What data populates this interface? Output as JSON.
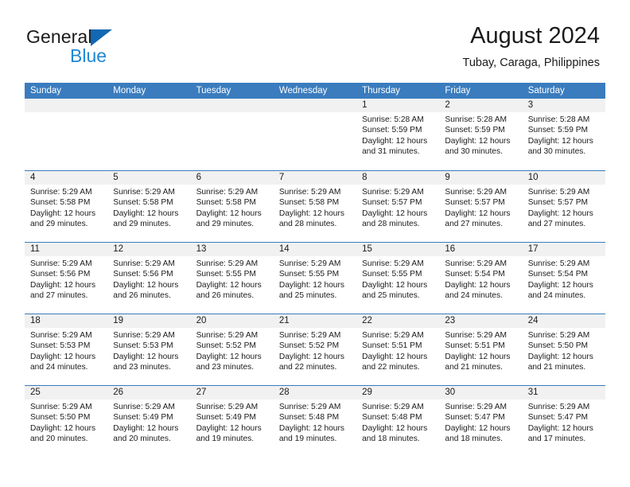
{
  "brand": {
    "name_part1": "General",
    "name_part2": "Blue",
    "logo_color": "#1268b3",
    "accent_color": "#2087d4"
  },
  "header": {
    "title": "August 2024",
    "subtitle": "Tubay, Caraga, Philippines"
  },
  "theme": {
    "header_row_bg": "#3a7cbe",
    "daynum_band_bg": "#f1f1f1",
    "grid_line": "#3a7cbe",
    "text": "#1b1b1b"
  },
  "weekdays": [
    "Sunday",
    "Monday",
    "Tuesday",
    "Wednesday",
    "Thursday",
    "Friday",
    "Saturday"
  ],
  "labels": {
    "sunrise_prefix": "Sunrise:",
    "sunset_prefix": "Sunset:",
    "daylight_prefix": "Daylight:"
  },
  "weeks": [
    [
      {
        "day": "",
        "sunrise": "",
        "sunset": "",
        "daylight_line1": "",
        "daylight_line2": "",
        "empty": true
      },
      {
        "day": "",
        "sunrise": "",
        "sunset": "",
        "daylight_line1": "",
        "daylight_line2": "",
        "empty": true
      },
      {
        "day": "",
        "sunrise": "",
        "sunset": "",
        "daylight_line1": "",
        "daylight_line2": "",
        "empty": true
      },
      {
        "day": "",
        "sunrise": "",
        "sunset": "",
        "daylight_line1": "",
        "daylight_line2": "",
        "empty": true
      },
      {
        "day": "1",
        "sunrise": "Sunrise: 5:28 AM",
        "sunset": "Sunset: 5:59 PM",
        "daylight_line1": "Daylight: 12 hours",
        "daylight_line2": "and 31 minutes."
      },
      {
        "day": "2",
        "sunrise": "Sunrise: 5:28 AM",
        "sunset": "Sunset: 5:59 PM",
        "daylight_line1": "Daylight: 12 hours",
        "daylight_line2": "and 30 minutes."
      },
      {
        "day": "3",
        "sunrise": "Sunrise: 5:28 AM",
        "sunset": "Sunset: 5:59 PM",
        "daylight_line1": "Daylight: 12 hours",
        "daylight_line2": "and 30 minutes."
      }
    ],
    [
      {
        "day": "4",
        "sunrise": "Sunrise: 5:29 AM",
        "sunset": "Sunset: 5:58 PM",
        "daylight_line1": "Daylight: 12 hours",
        "daylight_line2": "and 29 minutes."
      },
      {
        "day": "5",
        "sunrise": "Sunrise: 5:29 AM",
        "sunset": "Sunset: 5:58 PM",
        "daylight_line1": "Daylight: 12 hours",
        "daylight_line2": "and 29 minutes."
      },
      {
        "day": "6",
        "sunrise": "Sunrise: 5:29 AM",
        "sunset": "Sunset: 5:58 PM",
        "daylight_line1": "Daylight: 12 hours",
        "daylight_line2": "and 29 minutes."
      },
      {
        "day": "7",
        "sunrise": "Sunrise: 5:29 AM",
        "sunset": "Sunset: 5:58 PM",
        "daylight_line1": "Daylight: 12 hours",
        "daylight_line2": "and 28 minutes."
      },
      {
        "day": "8",
        "sunrise": "Sunrise: 5:29 AM",
        "sunset": "Sunset: 5:57 PM",
        "daylight_line1": "Daylight: 12 hours",
        "daylight_line2": "and 28 minutes."
      },
      {
        "day": "9",
        "sunrise": "Sunrise: 5:29 AM",
        "sunset": "Sunset: 5:57 PM",
        "daylight_line1": "Daylight: 12 hours",
        "daylight_line2": "and 27 minutes."
      },
      {
        "day": "10",
        "sunrise": "Sunrise: 5:29 AM",
        "sunset": "Sunset: 5:57 PM",
        "daylight_line1": "Daylight: 12 hours",
        "daylight_line2": "and 27 minutes."
      }
    ],
    [
      {
        "day": "11",
        "sunrise": "Sunrise: 5:29 AM",
        "sunset": "Sunset: 5:56 PM",
        "daylight_line1": "Daylight: 12 hours",
        "daylight_line2": "and 27 minutes."
      },
      {
        "day": "12",
        "sunrise": "Sunrise: 5:29 AM",
        "sunset": "Sunset: 5:56 PM",
        "daylight_line1": "Daylight: 12 hours",
        "daylight_line2": "and 26 minutes."
      },
      {
        "day": "13",
        "sunrise": "Sunrise: 5:29 AM",
        "sunset": "Sunset: 5:55 PM",
        "daylight_line1": "Daylight: 12 hours",
        "daylight_line2": "and 26 minutes."
      },
      {
        "day": "14",
        "sunrise": "Sunrise: 5:29 AM",
        "sunset": "Sunset: 5:55 PM",
        "daylight_line1": "Daylight: 12 hours",
        "daylight_line2": "and 25 minutes."
      },
      {
        "day": "15",
        "sunrise": "Sunrise: 5:29 AM",
        "sunset": "Sunset: 5:55 PM",
        "daylight_line1": "Daylight: 12 hours",
        "daylight_line2": "and 25 minutes."
      },
      {
        "day": "16",
        "sunrise": "Sunrise: 5:29 AM",
        "sunset": "Sunset: 5:54 PM",
        "daylight_line1": "Daylight: 12 hours",
        "daylight_line2": "and 24 minutes."
      },
      {
        "day": "17",
        "sunrise": "Sunrise: 5:29 AM",
        "sunset": "Sunset: 5:54 PM",
        "daylight_line1": "Daylight: 12 hours",
        "daylight_line2": "and 24 minutes."
      }
    ],
    [
      {
        "day": "18",
        "sunrise": "Sunrise: 5:29 AM",
        "sunset": "Sunset: 5:53 PM",
        "daylight_line1": "Daylight: 12 hours",
        "daylight_line2": "and 24 minutes."
      },
      {
        "day": "19",
        "sunrise": "Sunrise: 5:29 AM",
        "sunset": "Sunset: 5:53 PM",
        "daylight_line1": "Daylight: 12 hours",
        "daylight_line2": "and 23 minutes."
      },
      {
        "day": "20",
        "sunrise": "Sunrise: 5:29 AM",
        "sunset": "Sunset: 5:52 PM",
        "daylight_line1": "Daylight: 12 hours",
        "daylight_line2": "and 23 minutes."
      },
      {
        "day": "21",
        "sunrise": "Sunrise: 5:29 AM",
        "sunset": "Sunset: 5:52 PM",
        "daylight_line1": "Daylight: 12 hours",
        "daylight_line2": "and 22 minutes."
      },
      {
        "day": "22",
        "sunrise": "Sunrise: 5:29 AM",
        "sunset": "Sunset: 5:51 PM",
        "daylight_line1": "Daylight: 12 hours",
        "daylight_line2": "and 22 minutes."
      },
      {
        "day": "23",
        "sunrise": "Sunrise: 5:29 AM",
        "sunset": "Sunset: 5:51 PM",
        "daylight_line1": "Daylight: 12 hours",
        "daylight_line2": "and 21 minutes."
      },
      {
        "day": "24",
        "sunrise": "Sunrise: 5:29 AM",
        "sunset": "Sunset: 5:50 PM",
        "daylight_line1": "Daylight: 12 hours",
        "daylight_line2": "and 21 minutes."
      }
    ],
    [
      {
        "day": "25",
        "sunrise": "Sunrise: 5:29 AM",
        "sunset": "Sunset: 5:50 PM",
        "daylight_line1": "Daylight: 12 hours",
        "daylight_line2": "and 20 minutes."
      },
      {
        "day": "26",
        "sunrise": "Sunrise: 5:29 AM",
        "sunset": "Sunset: 5:49 PM",
        "daylight_line1": "Daylight: 12 hours",
        "daylight_line2": "and 20 minutes."
      },
      {
        "day": "27",
        "sunrise": "Sunrise: 5:29 AM",
        "sunset": "Sunset: 5:49 PM",
        "daylight_line1": "Daylight: 12 hours",
        "daylight_line2": "and 19 minutes."
      },
      {
        "day": "28",
        "sunrise": "Sunrise: 5:29 AM",
        "sunset": "Sunset: 5:48 PM",
        "daylight_line1": "Daylight: 12 hours",
        "daylight_line2": "and 19 minutes."
      },
      {
        "day": "29",
        "sunrise": "Sunrise: 5:29 AM",
        "sunset": "Sunset: 5:48 PM",
        "daylight_line1": "Daylight: 12 hours",
        "daylight_line2": "and 18 minutes."
      },
      {
        "day": "30",
        "sunrise": "Sunrise: 5:29 AM",
        "sunset": "Sunset: 5:47 PM",
        "daylight_line1": "Daylight: 12 hours",
        "daylight_line2": "and 18 minutes."
      },
      {
        "day": "31",
        "sunrise": "Sunrise: 5:29 AM",
        "sunset": "Sunset: 5:47 PM",
        "daylight_line1": "Daylight: 12 hours",
        "daylight_line2": "and 17 minutes."
      }
    ]
  ]
}
